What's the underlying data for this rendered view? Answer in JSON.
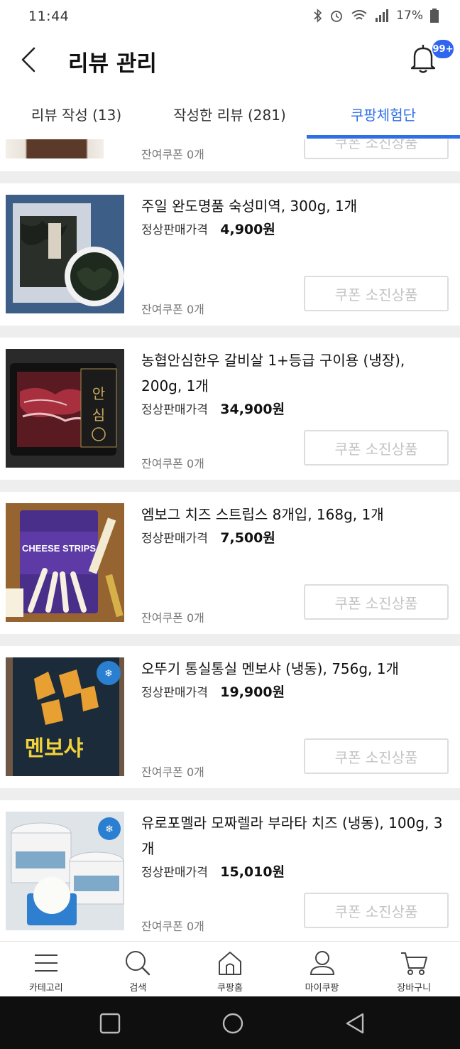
{
  "status_bar": {
    "time": "11:44",
    "battery": "17%"
  },
  "header": {
    "title": "리뷰 관리",
    "badge": "99+"
  },
  "tabs": [
    {
      "label": "리뷰 작성 (13)",
      "active": false
    },
    {
      "label": "작성한 리뷰 (281)",
      "active": false
    },
    {
      "label": "쿠팡체험단",
      "active": true
    }
  ],
  "colors": {
    "accent": "#2f6fe6",
    "badge": "#3065f0",
    "divider": "#eeeeee"
  },
  "partial_item": {
    "coupon_left": "잔여쿠폰 0개",
    "coupon_button": "쿠폰 소진상품"
  },
  "items": [
    {
      "name": "주일 완도명품 숙성미역, 300g, 1개",
      "price_label": "정상판매가격",
      "price": "4,900원",
      "coupon_left": "잔여쿠폰 0개",
      "coupon_button": "쿠폰 소진상품"
    },
    {
      "name": "농협안심한우 갈비살 1+등급 구이용 (냉장), 200g, 1개",
      "price_label": "정상판매가격",
      "price": "34,900원",
      "coupon_left": "잔여쿠폰 0개",
      "coupon_button": "쿠폰 소진상품"
    },
    {
      "name": "엠보그 치즈 스트립스 8개입, 168g, 1개",
      "price_label": "정상판매가격",
      "price": "7,500원",
      "coupon_left": "잔여쿠폰 0개",
      "coupon_button": "쿠폰 소진상품",
      "thumb_text": "CHEESE STRIPS"
    },
    {
      "name": "오뚜기 통실통실 멘보샤 (냉동), 756g, 1개",
      "price_label": "정상판매가격",
      "price": "19,900원",
      "coupon_left": "잔여쿠폰 0개",
      "coupon_button": "쿠폰 소진상품",
      "thumb_text": "멘보샤"
    },
    {
      "name": "유로포멜라 모짜렐라 부라타 치즈 (냉동), 100g, 3개",
      "price_label": "정상판매가격",
      "price": "15,010원",
      "coupon_left": "잔여쿠폰 0개",
      "coupon_button": "쿠폰 소진상품"
    }
  ],
  "bottom_nav": [
    {
      "label": "카테고리",
      "icon": "menu-icon"
    },
    {
      "label": "검색",
      "icon": "search-icon"
    },
    {
      "label": "쿠팡홈",
      "icon": "home-icon"
    },
    {
      "label": "마이쿠팡",
      "icon": "user-icon"
    },
    {
      "label": "장바구니",
      "icon": "cart-icon"
    }
  ]
}
